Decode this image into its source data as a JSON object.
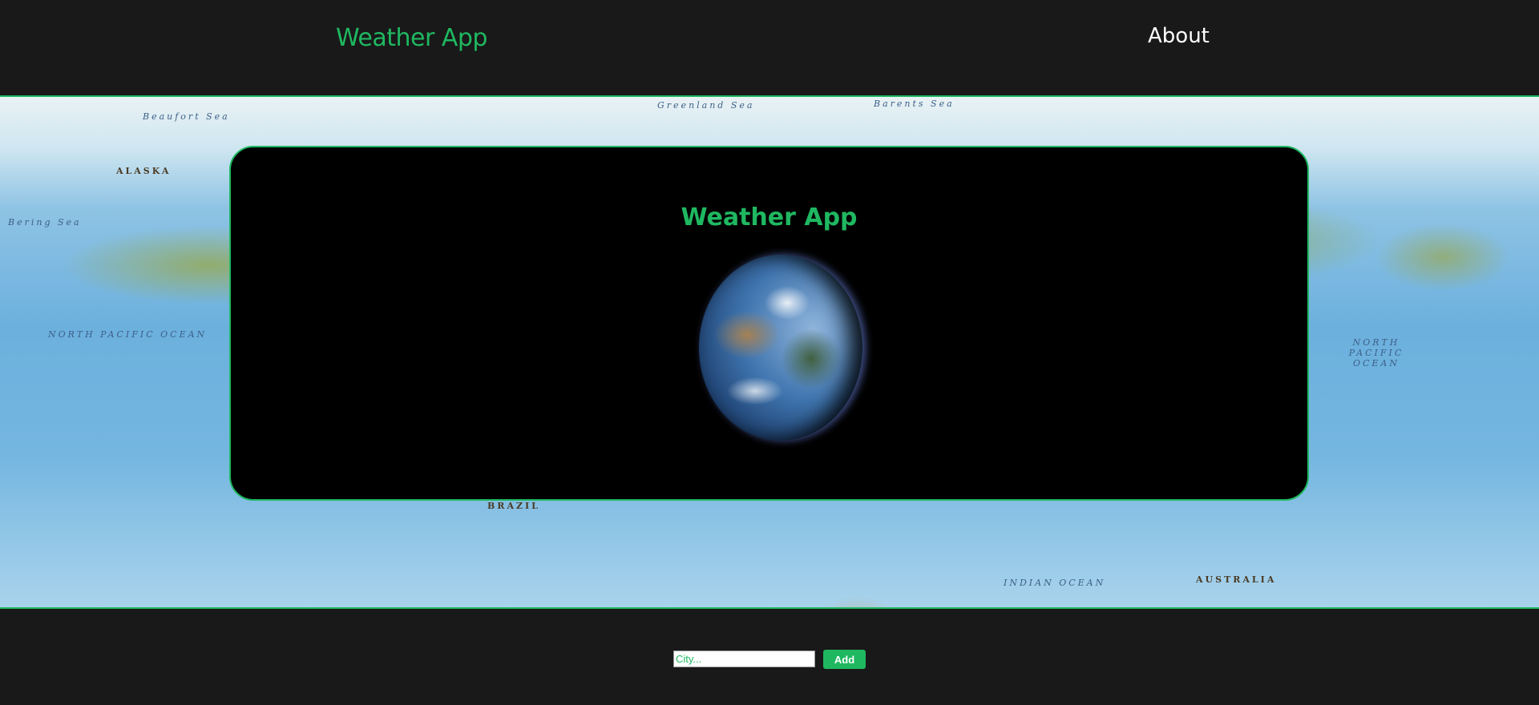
{
  "header": {
    "brand": "Weather App",
    "nav": {
      "about": "About"
    }
  },
  "map_labels": {
    "beaufort": "Beaufort Sea",
    "barents": "Barents Sea",
    "north_pacific": "NORTH PACIFIC OCEAN",
    "north_pacific_right": "NORTH PACIFIC OCEAN",
    "brazil": "BRAZIL",
    "indian": "INDIAN OCEAN",
    "australia": "AUSTRALIA",
    "bering": "Bering Sea",
    "alaska": "ALASKA",
    "greenland": "Greenland Sea"
  },
  "card": {
    "title": "Weather App"
  },
  "form": {
    "city_placeholder": "City...",
    "add_label": "Add"
  },
  "colors": {
    "accent": "#1fb861",
    "page_background": "#191919",
    "card_background": "#000000"
  }
}
